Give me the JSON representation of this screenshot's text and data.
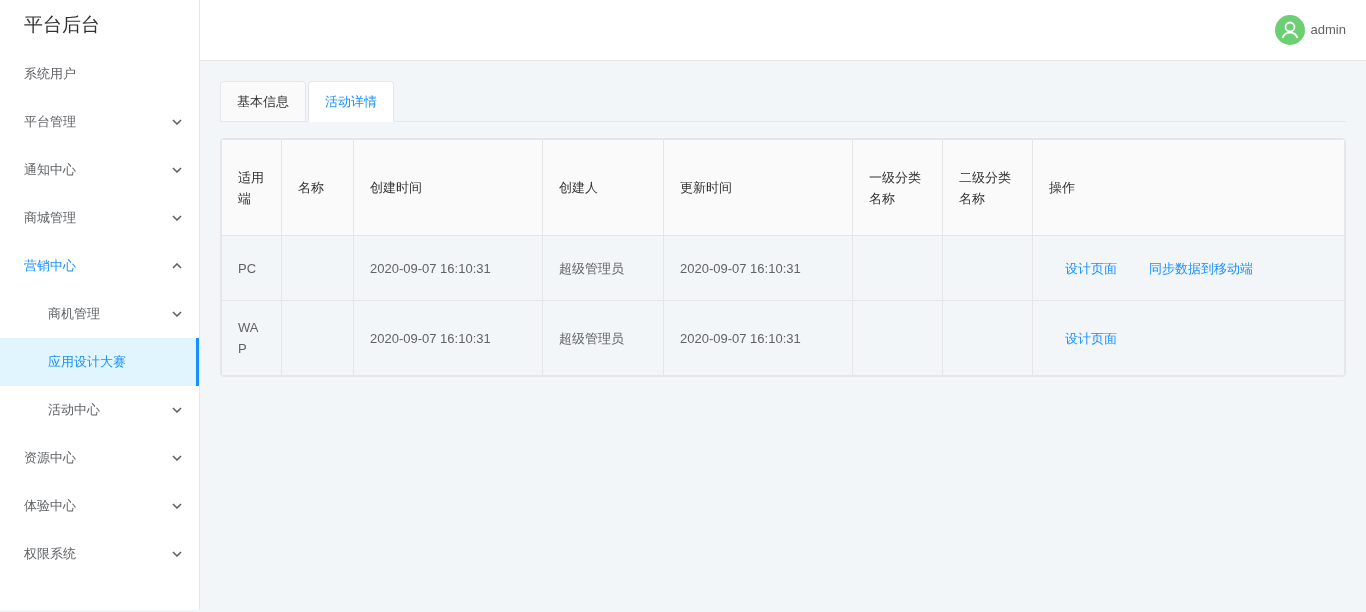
{
  "sidebar": {
    "title": "平台后台",
    "items": [
      {
        "label": "系统用户",
        "kind": "link",
        "selected": false
      },
      {
        "label": "平台管理",
        "kind": "submenu",
        "expanded": false,
        "selected": false
      },
      {
        "label": "通知中心",
        "kind": "submenu",
        "expanded": false,
        "selected": false
      },
      {
        "label": "商城管理",
        "kind": "submenu",
        "expanded": false,
        "selected": false
      },
      {
        "label": "营销中心",
        "kind": "submenu",
        "expanded": true,
        "selected": false,
        "children": [
          {
            "label": "商机管理",
            "kind": "submenu",
            "expanded": false,
            "selected": false
          },
          {
            "label": "应用设计大赛",
            "kind": "link",
            "selected": true
          },
          {
            "label": "活动中心",
            "kind": "submenu",
            "expanded": false,
            "selected": false
          }
        ]
      },
      {
        "label": "资源中心",
        "kind": "submenu",
        "expanded": false,
        "selected": false
      },
      {
        "label": "体验中心",
        "kind": "submenu",
        "expanded": false,
        "selected": false
      },
      {
        "label": "权限系统",
        "kind": "submenu",
        "expanded": false,
        "selected": false
      }
    ]
  },
  "header": {
    "user": "admin"
  },
  "tabs": [
    {
      "label": "基本信息",
      "selected": false
    },
    {
      "label": "活动详情",
      "selected": true
    }
  ],
  "table": {
    "columns": [
      "适用端",
      "名称",
      "创建时间",
      "创建人",
      "更新时间",
      "一级分类名称",
      "二级分类名称",
      "操作"
    ],
    "rows": [
      {
        "platform": "PC",
        "created_at": "2020-09-07 16:10:31",
        "creator": "超级管理员",
        "updated_at": "2020-09-07 16:10:31",
        "actions": [
          "设计页面",
          "同步数据到移动端"
        ]
      },
      {
        "platform": "WAP",
        "created_at": "2020-09-07 16:10:31",
        "creator": "超级管理员",
        "updated_at": "2020-09-07 16:10:31",
        "actions": [
          "设计页面"
        ]
      }
    ]
  }
}
